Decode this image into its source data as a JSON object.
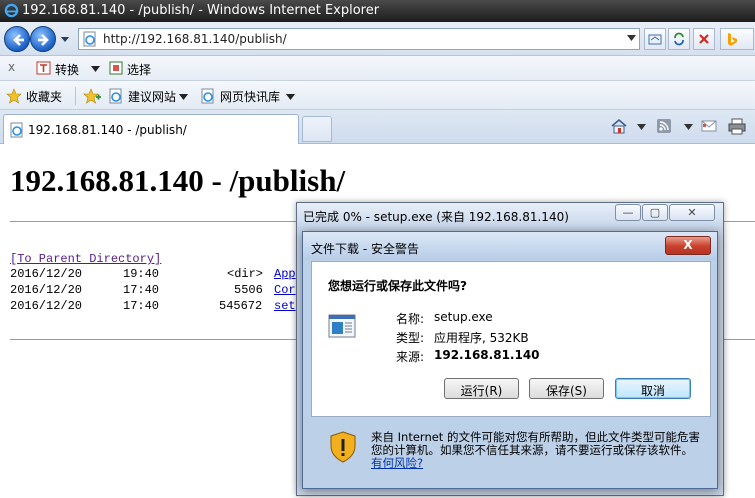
{
  "window": {
    "title": "192.168.81.140 - /publish/ - Windows Internet Explorer"
  },
  "address": {
    "url": "http://192.168.81.140/publish/"
  },
  "command_bar": {
    "close_symbol": "x",
    "translate_label": "转换",
    "select_label": "选择"
  },
  "favorites_bar": {
    "favorites_label": "收藏夹",
    "suggested_sites": "建议网站",
    "web_slice": "网页快讯库"
  },
  "tab": {
    "label": "192.168.81.140 - /publish/"
  },
  "page": {
    "heading": "192.168.81.140 - /publish/",
    "parent_link": "[To Parent Directory]",
    "rows": [
      {
        "date": "2016/12/20",
        "time": "19:40",
        "size": "<dir>",
        "name": "App"
      },
      {
        "date": "2016/12/20",
        "time": "17:40",
        "size": "5506",
        "name": "Cor"
      },
      {
        "date": "2016/12/20",
        "time": "17:40",
        "size": "545672",
        "name": "set"
      }
    ]
  },
  "progress_window": {
    "title": "已完成 0% - setup.exe (来自 192.168.81.140)"
  },
  "dialog": {
    "title": "文件下载 - 安全警告",
    "close_label": "X",
    "question": "您想运行或保存此文件吗?",
    "name_label": "名称:",
    "name_value": "setup.exe",
    "type_label": "类型:",
    "type_value": "应用程序, 532KB",
    "from_label": "来源:",
    "from_value": "192.168.81.140",
    "run_button": "运行(R)",
    "save_button": "保存(S)",
    "cancel_button": "取消",
    "warning_text": "来自 Internet 的文件可能对您有所帮助，但此文件类型可能危害您的计算机。如果您不信任其来源，请不要运行或保存该软件。",
    "risk_link": "有何风险?"
  },
  "colors": {
    "link": "#0000cc",
    "visited_link": "#551a8b",
    "close_red": "#c9402c"
  }
}
